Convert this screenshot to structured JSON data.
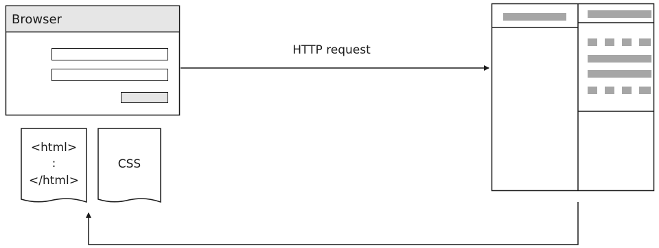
{
  "browser": {
    "title": "Browser"
  },
  "documents": {
    "html": {
      "line1": "<html>",
      "line2": ":",
      "line3": "</html>"
    },
    "css": {
      "label": "CSS"
    }
  },
  "connections": {
    "request_label": "HTTP request"
  },
  "colors": {
    "stroke": "#1a1a1a",
    "titlebar": "#e6e6e6",
    "placeholder": "#a6a6a6",
    "button": "#e6e6e6"
  }
}
